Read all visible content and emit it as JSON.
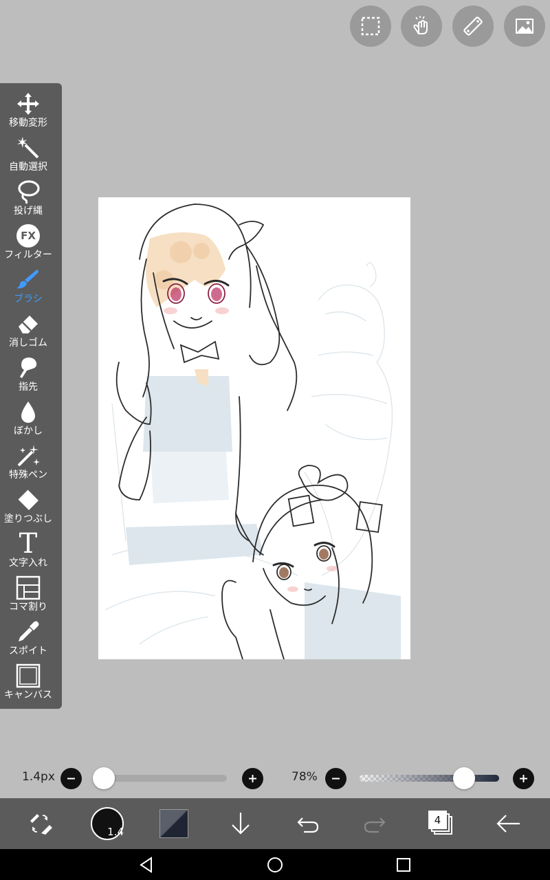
{
  "toolbar": {
    "tools": [
      {
        "label": "移動変形"
      },
      {
        "label": "自動選択"
      },
      {
        "label": "投げ縄"
      },
      {
        "label": "フィルター",
        "icon_text": "FX"
      },
      {
        "label": "ブラシ"
      },
      {
        "label": "消しゴム"
      },
      {
        "label": "指先"
      },
      {
        "label": "ぼかし"
      },
      {
        "label": "特殊ペン"
      },
      {
        "label": "塗りつぶし"
      },
      {
        "label": "文字入れ",
        "icon_text": "T"
      },
      {
        "label": "コマ割り"
      },
      {
        "label": "スポイト"
      },
      {
        "label": "キャンバス"
      }
    ],
    "active_tool": "ブラシ",
    "active_color": "#3f9bff"
  },
  "brush_size": {
    "label": "1.4px",
    "value": 1.4,
    "min": 0,
    "max": 100
  },
  "opacity": {
    "label": "78%",
    "value": 78
  },
  "bottom": {
    "brush_size_badge": "1.4",
    "layer_count": "4",
    "main_color": "#111111"
  },
  "colors": {
    "toolbar": "#5b5b5b",
    "background": "#bdbdbd",
    "canvas": "#ffffff",
    "sketch_blue": "#dce6ec",
    "skin": "#f6dfc2"
  }
}
